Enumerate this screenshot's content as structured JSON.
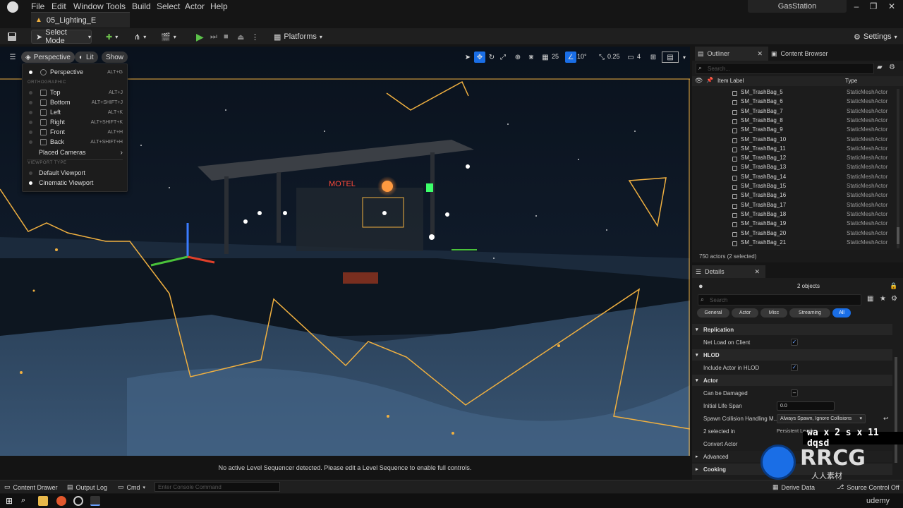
{
  "menu": [
    "File",
    "Edit",
    "Window",
    "Tools",
    "Build",
    "Select",
    "Actor",
    "Help"
  ],
  "document_tab": "05_Lighting_E",
  "project_name": "GasStation",
  "toolbar": {
    "select_mode": "Select Mode",
    "platforms": "Platforms",
    "settings": "Settings"
  },
  "viewport": {
    "perspective_label": "Perspective",
    "lit_label": "Lit",
    "show_label": "Show",
    "grid_value": "25",
    "rotation_value": "10°",
    "scale_value": "0.25",
    "camera_speed": "4",
    "status_message": "No active Level Sequencer detected. Please edit a Level Sequence to enable full controls.",
    "motel_sign": "MOTEL"
  },
  "perspective_menu": {
    "perspective": {
      "label": "Perspective",
      "shortcut": "ALT+G"
    },
    "orthographic_header": "ORTHOGRAPHIC",
    "ortho_items": [
      {
        "label": "Top",
        "shortcut": "ALT+J"
      },
      {
        "label": "Bottom",
        "shortcut": "ALT+SHIFT+J"
      },
      {
        "label": "Left",
        "shortcut": "ALT+K"
      },
      {
        "label": "Right",
        "shortcut": "ALT+SHIFT+K"
      },
      {
        "label": "Front",
        "shortcut": "ALT+H"
      },
      {
        "label": "Back",
        "shortcut": "ALT+SHIFT+H"
      }
    ],
    "placed_cameras": "Placed Cameras",
    "viewport_type_header": "VIEWPORT TYPE",
    "viewport_types": [
      "Default Viewport",
      "Cinematic Viewport"
    ]
  },
  "outliner": {
    "tab_label": "Outliner",
    "content_browser_label": "Content Browser",
    "search_placeholder": "Search...",
    "col_item_label": "Item Label",
    "col_type": "Type",
    "rows": [
      {
        "name": "SM_TrashBag_5",
        "type": "StaticMeshActor"
      },
      {
        "name": "SM_TrashBag_6",
        "type": "StaticMeshActor"
      },
      {
        "name": "SM_TrashBag_7",
        "type": "StaticMeshActor"
      },
      {
        "name": "SM_TrashBag_8",
        "type": "StaticMeshActor"
      },
      {
        "name": "SM_TrashBag_9",
        "type": "StaticMeshActor"
      },
      {
        "name": "SM_TrashBag_10",
        "type": "StaticMeshActor"
      },
      {
        "name": "SM_TrashBag_11",
        "type": "StaticMeshActor"
      },
      {
        "name": "SM_TrashBag_12",
        "type": "StaticMeshActor"
      },
      {
        "name": "SM_TrashBag_13",
        "type": "StaticMeshActor"
      },
      {
        "name": "SM_TrashBag_14",
        "type": "StaticMeshActor"
      },
      {
        "name": "SM_TrashBag_15",
        "type": "StaticMeshActor"
      },
      {
        "name": "SM_TrashBag_16",
        "type": "StaticMeshActor"
      },
      {
        "name": "SM_TrashBag_17",
        "type": "StaticMeshActor"
      },
      {
        "name": "SM_TrashBag_18",
        "type": "StaticMeshActor"
      },
      {
        "name": "SM_TrashBag_19",
        "type": "StaticMeshActor"
      },
      {
        "name": "SM_TrashBag_20",
        "type": "StaticMeshActor"
      },
      {
        "name": "SM_TrashBag_21",
        "type": "StaticMeshActor"
      }
    ],
    "footer": "750 actors (2 selected)"
  },
  "details": {
    "tab_label": "Details",
    "objects_count": "2 objects",
    "search_placeholder": "Search",
    "filters": [
      "General",
      "Actor",
      "Misc",
      "Streaming",
      "All"
    ],
    "sections": {
      "replication": "Replication",
      "hlod": "HLOD",
      "actor": "Actor",
      "advanced": "Advanced",
      "cooking": "Cooking"
    },
    "props": {
      "net_load": "Net Load on Client",
      "include_hlod": "Include Actor in HLOD",
      "can_be_damaged": "Can be Damaged",
      "initial_life_span": "Initial Life Span",
      "initial_life_span_value": "0.0",
      "spawn_collision": "Spawn Collision Handling M...",
      "spawn_collision_value": "Always Spawn, Ignore Collisions",
      "selected_in": "2 selected in",
      "selected_in_value": "Persistent Level",
      "convert_actor": "Convert Actor"
    },
    "footer_left": "Derive Data",
    "footer_right": "Source Control Off"
  },
  "bottom": {
    "content_drawer": "Content Drawer",
    "output_log": "Output Log",
    "cmd": "Cmd",
    "console_placeholder": "Enter Console Command"
  },
  "watermark": "wa x 2 s x 11 dqsd",
  "brand": {
    "rrcg": "RRCG",
    "subtitle": "人人素材",
    "udemy": "udemy"
  },
  "colors": {
    "accent": "#f0b040",
    "selection": "#1a6ee6"
  }
}
